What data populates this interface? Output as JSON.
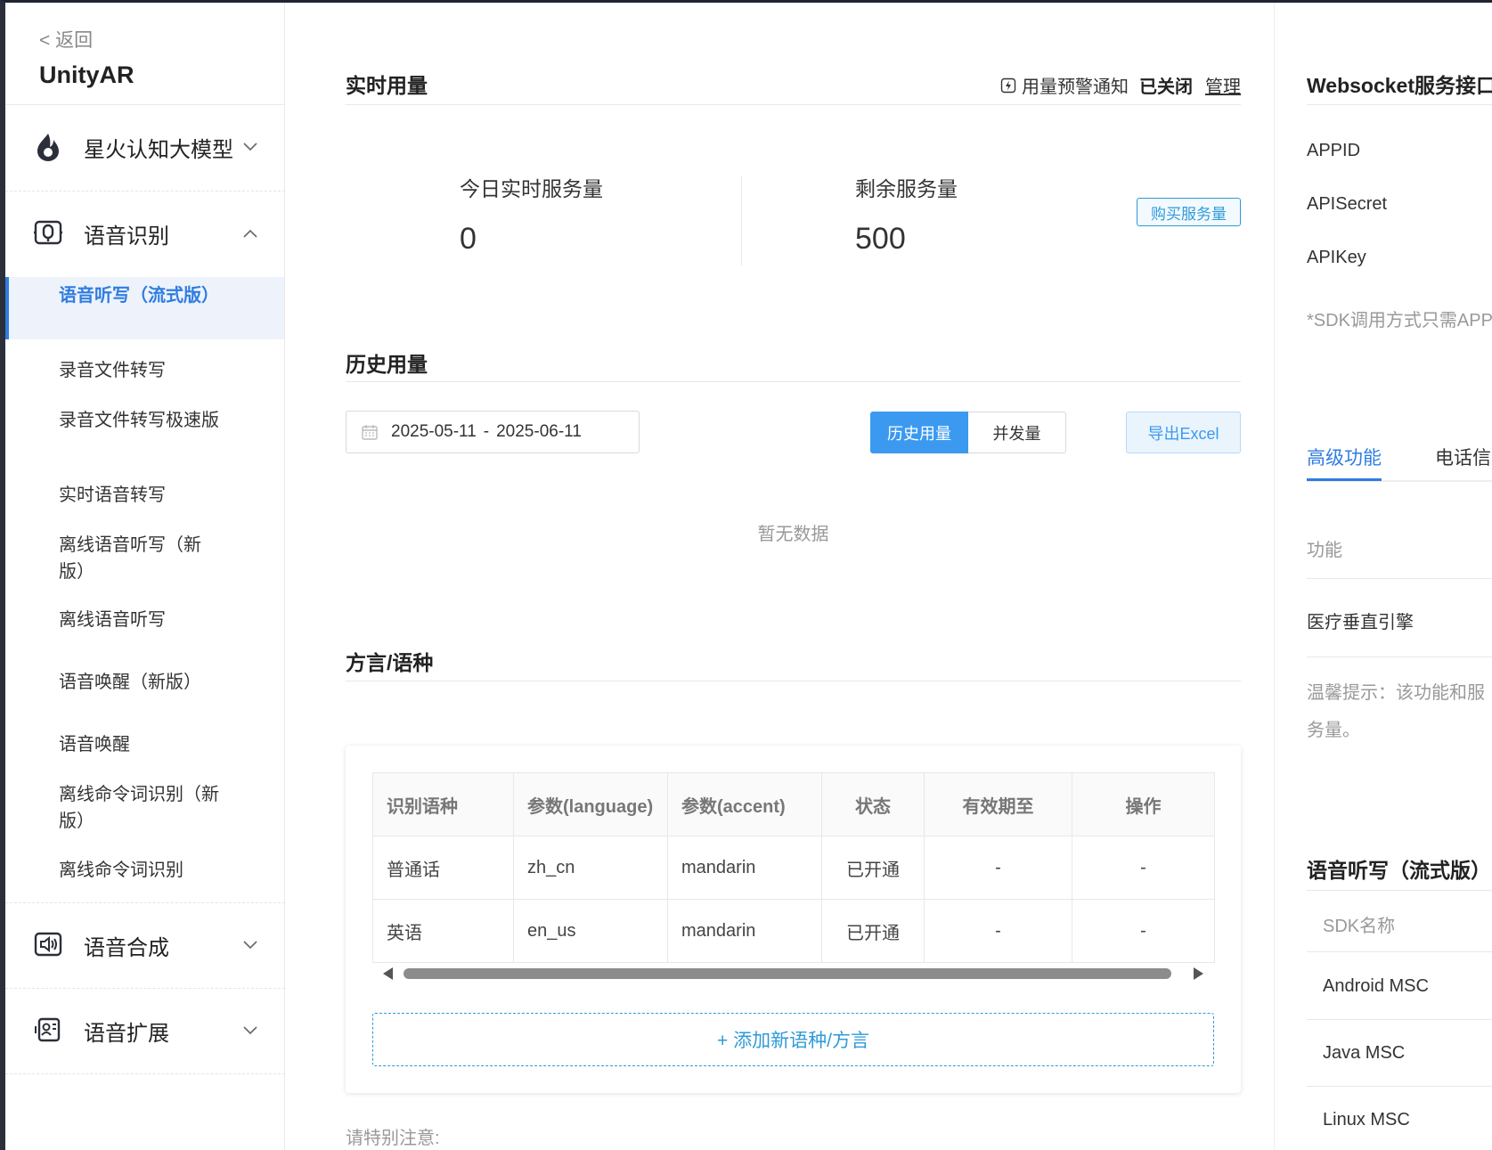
{
  "sidebar": {
    "back": "< 返回",
    "app_title": "UnityAR",
    "groups": [
      {
        "label": "星火认知大模型",
        "icon": "flame-icon",
        "expanded": false
      },
      {
        "label": "语音识别",
        "icon": "speech-recognition-icon",
        "expanded": true
      },
      {
        "label": "语音合成",
        "icon": "speech-synthesis-icon",
        "expanded": false
      },
      {
        "label": "语音扩展",
        "icon": "speech-extension-icon",
        "expanded": false
      }
    ],
    "sub_items": [
      "语音听写（流式版）",
      "录音文件转写",
      "录音文件转写极速版",
      "实时语音转写",
      "离线语音听写（新版）",
      "离线语音听写",
      "语音唤醒（新版）",
      "语音唤醒",
      "离线命令词识别（新版）",
      "离线命令词识别"
    ]
  },
  "realtime": {
    "title": "实时用量",
    "alert_label": "用量预警通知",
    "alert_status": "已关闭",
    "manage": "管理",
    "today_label": "今日实时服务量",
    "today_value": "0",
    "remaining_label": "剩余服务量",
    "remaining_value": "500",
    "buy_button": "购买服务量"
  },
  "history": {
    "title": "历史用量",
    "date_start": "2025-05-11",
    "date_sep": "-",
    "date_end": "2025-06-11",
    "tab_history": "历史用量",
    "tab_concurrency": "并发量",
    "export": "导出Excel",
    "no_data": "暂无数据"
  },
  "dialect": {
    "title": "方言/语种",
    "columns": [
      "识别语种",
      "参数(language)",
      "参数(accent)",
      "状态",
      "有效期至",
      "操作"
    ],
    "rows": [
      [
        "普通话",
        "zh_cn",
        "mandarin",
        "已开通",
        "-",
        "-"
      ],
      [
        "英语",
        "en_us",
        "mandarin",
        "已开通",
        "-",
        "-"
      ]
    ],
    "add_button": "+ 添加新语种/方言",
    "note": "请特别注意:"
  },
  "right_panel": {
    "title": "Websocket服务接口",
    "keys": [
      "APPID",
      "APISecret",
      "APIKey"
    ],
    "sdk_hint": "*SDK调用方式只需APPID",
    "tabs": [
      "高级功能",
      "电话信道"
    ],
    "feature_header": "功能",
    "feature_item": "医疗垂直引擎",
    "tip_line1": "温馨提示：该功能和服",
    "tip_line2": "务量。",
    "sdk_title": "语音听写（流式版）",
    "sdk_header": "SDK名称",
    "sdks": [
      "Android MSC",
      "Java MSC",
      "Linux MSC"
    ]
  },
  "colors": {
    "accent": "#2f7de1",
    "primary_button": "#3b9af0",
    "link": "#2f9ad8"
  }
}
